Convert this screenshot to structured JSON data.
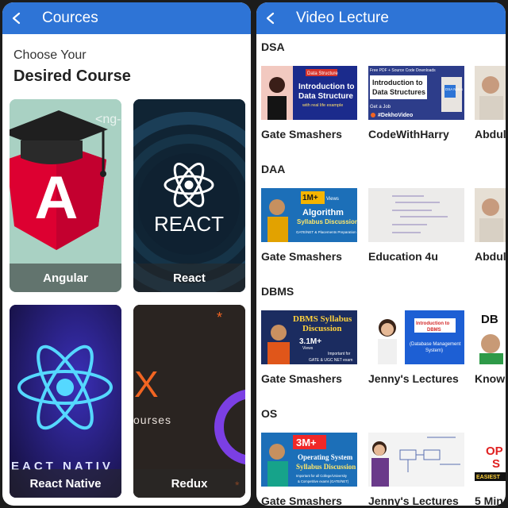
{
  "left_screen": {
    "title": "Cources",
    "heading_small": "Choose Your",
    "heading_big": "Desired Course",
    "courses": [
      {
        "label": "Angular",
        "logo_text": "A",
        "bg_text": "<ng-"
      },
      {
        "label": "React",
        "logo_text": "REACT"
      },
      {
        "label": "React Native",
        "logo_text": "EACT NATIV"
      },
      {
        "label": "Redux",
        "logo_text": "X",
        "sub_text": "ourses"
      }
    ]
  },
  "right_screen": {
    "title": "Video Lecture",
    "sections": [
      {
        "name": "DSA",
        "videos": [
          {
            "channel": "Gate Smashers",
            "thumb_lines": [
              "Data Structure",
              "Introduction to",
              "Data Structure",
              "with real life example"
            ]
          },
          {
            "channel": "CodeWithHarry",
            "thumb_lines": [
              "Free PDF + Source Code Downloads",
              "Introduction to",
              "Data Structures",
              "DSA Notes",
              "Get a Job",
              "#DekhoVideo"
            ]
          },
          {
            "channel": "Abdul",
            "thumb_lines": []
          }
        ]
      },
      {
        "name": "DAA",
        "videos": [
          {
            "channel": "Gate Smashers",
            "thumb_lines": [
              "1M+",
              "Views",
              "Algorithm",
              "Syllabus Discussion",
              "GATE/NET & Placements Preparation"
            ]
          },
          {
            "channel": "Education 4u",
            "thumb_lines": []
          },
          {
            "channel": "Abdul",
            "thumb_lines": []
          }
        ]
      },
      {
        "name": "DBMS",
        "videos": [
          {
            "channel": "Gate Smashers",
            "thumb_lines": [
              "DBMS Syllabus",
              "Discussion",
              "3.1M+",
              "Views",
              "Important for",
              "GATE & UGC NET exam"
            ]
          },
          {
            "channel": "Jenny's Lectures",
            "thumb_lines": [
              "Introduction to",
              "DBMS",
              "(Database Management",
              "System)"
            ]
          },
          {
            "channel": "Knowl",
            "thumb_lines": [
              "DB"
            ]
          }
        ]
      },
      {
        "name": "OS",
        "videos": [
          {
            "channel": "Gate Smashers",
            "thumb_lines": [
              "3M+",
              "Operating System",
              "Syllabus Discussion",
              "Important for all College/University",
              "& Competitive exams (GATE/NET)"
            ]
          },
          {
            "channel": "Jenny's Lectures",
            "thumb_lines": []
          },
          {
            "channel": "5 Min",
            "thumb_lines": [
              "OP",
              "S",
              "EASIEST"
            ]
          }
        ]
      }
    ]
  },
  "colors": {
    "appbar": "#2e74d6",
    "accent_red": "#dd0031",
    "accent_orange": "#f26522"
  }
}
